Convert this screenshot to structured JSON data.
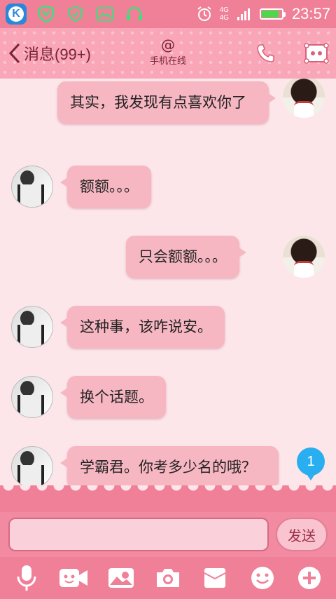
{
  "status_bar": {
    "network_top": "4G",
    "network_bottom": "4G",
    "time": "23:57",
    "battery_level": 0.85,
    "icons": [
      "k-app-icon",
      "shield-icon",
      "shield-check-icon",
      "image-icon",
      "headset-icon",
      "alarm-icon",
      "signal-icon",
      "battery-icon"
    ]
  },
  "header": {
    "back_label": "消息(99+)",
    "contact_name": "@",
    "contact_status": "手机在线",
    "actions": [
      "phone-icon",
      "contact-card-icon"
    ]
  },
  "messages": [
    {
      "side": "right",
      "text": "其实，我发现有点喜欢你了"
    },
    {
      "side": "left",
      "text": "额额。。。"
    },
    {
      "side": "right",
      "text": "只会额额。。。"
    },
    {
      "side": "left",
      "text": "这种事，该咋说安。"
    },
    {
      "side": "left",
      "text": "换个话题。"
    },
    {
      "side": "left",
      "text": "学霸君。你考多少名的哦？"
    }
  ],
  "unread_count": "1",
  "composer": {
    "placeholder": "",
    "send_label": "发送"
  },
  "toolbar": [
    "microphone-icon",
    "video-icon",
    "picture-icon",
    "camera-icon",
    "envelope-icon",
    "emoji-icon",
    "plus-icon"
  ],
  "colors": {
    "status_bar": "#f07f98",
    "header": "#f8a6b8",
    "background": "#fce6ea",
    "bubble": "#f7b7c2",
    "unread_badge": "#29aef0"
  }
}
